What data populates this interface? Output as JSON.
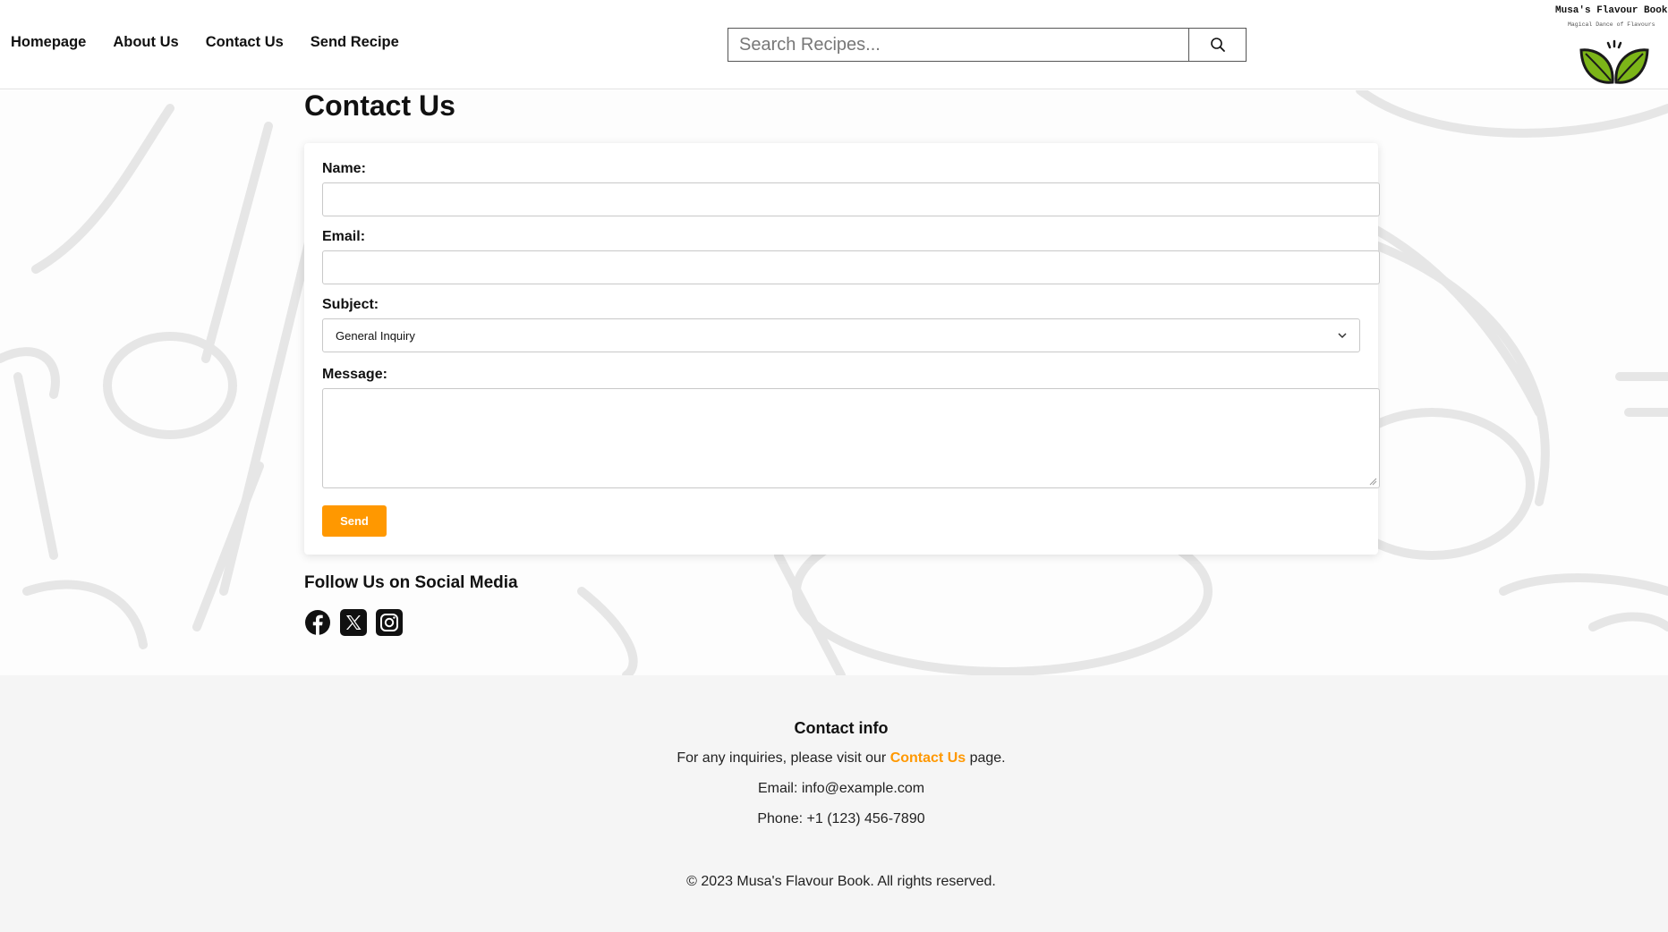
{
  "nav": {
    "items": [
      {
        "label": "Homepage"
      },
      {
        "label": "About Us"
      },
      {
        "label": "Contact Us"
      },
      {
        "label": "Send Recipe"
      }
    ]
  },
  "search": {
    "placeholder": "Search Recipes...",
    "icon": "search-icon"
  },
  "logo": {
    "title": "Musa's Flavour Book",
    "subtitle": "Magical Dance of Flavours",
    "icon": "leaf-icon"
  },
  "main": {
    "title": "Contact Us",
    "form": {
      "name_label": "Name:",
      "email_label": "Email:",
      "subject_label": "Subject:",
      "subject_value": "General Inquiry",
      "message_label": "Message:",
      "send_label": "Send"
    },
    "social": {
      "title": "Follow Us on Social Media",
      "icons": [
        "facebook-icon",
        "x-icon",
        "instagram-icon"
      ]
    }
  },
  "footer": {
    "title": "Contact info",
    "inquiry_prefix": "For any inquiries, please visit our ",
    "inquiry_link": "Contact Us",
    "inquiry_suffix": " page.",
    "email": "Email: info@example.com",
    "phone": "Phone: +1 (123) 456-7890",
    "copyright": "© 2023 Musa's Flavour Book. All rights reserved."
  },
  "colors": {
    "accent": "#ff9800",
    "leaf": "#7cb518"
  }
}
